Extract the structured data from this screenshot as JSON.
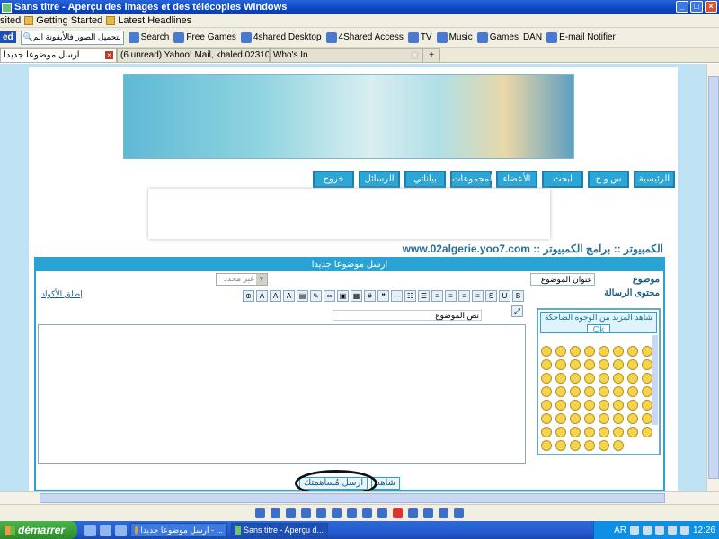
{
  "window": {
    "title": "Sans titre - Aperçu des images et des télécopies Windows"
  },
  "bookmarks": {
    "items": [
      "sited",
      "Getting Started",
      "Latest Headlines"
    ]
  },
  "toolbar": {
    "edition": "ed",
    "search_value": "لتحميل الصور فالأيقونة الم",
    "search_label": "Search",
    "items": [
      "Free Games",
      "4shared Desktop",
      "4Shared Access",
      "TV",
      "Music",
      "Games",
      "E-mail Notifier"
    ],
    "player_label": "DAN"
  },
  "tabs": [
    {
      "label": "ارسل موضوعا جديدا"
    },
    {
      "label": "(6 unread) Yahoo! Mail, khaled.02310"
    },
    {
      "label": "Who's In"
    }
  ],
  "forum": {
    "nav": [
      "الرئيسية",
      "س و ج",
      "ابحث",
      "الأعضاء",
      "المجموعات",
      "بياناتي",
      "الرسائل",
      "خروج"
    ],
    "breadcrumb": "www.02algerie.yoo7.com :: الكمبيوتر :: برامج الكمبيوتر",
    "form_title": "ارسل موضوعا جديدا",
    "subject_label": "موضوع",
    "subject_value": "عنوان الموضوع",
    "message_label": "محتوى الرسالة",
    "color_select": "غير محدد",
    "more_editor": "إطلق الأكواد",
    "title_field": "نص الموضوع",
    "smilies_tip": "شاهد المزيد من الوجوه الضاحكة",
    "smilies_ok": "Ok",
    "preview_button": "شاهد",
    "submit_button": "ارسل مُساهمتك"
  },
  "taskbar": {
    "start": "démarrer",
    "tasks": [
      "ارسل موضوعا جديدا - ...",
      "Sans titre - Aperçu d..."
    ],
    "lang": "AR",
    "clock": "12:26"
  }
}
